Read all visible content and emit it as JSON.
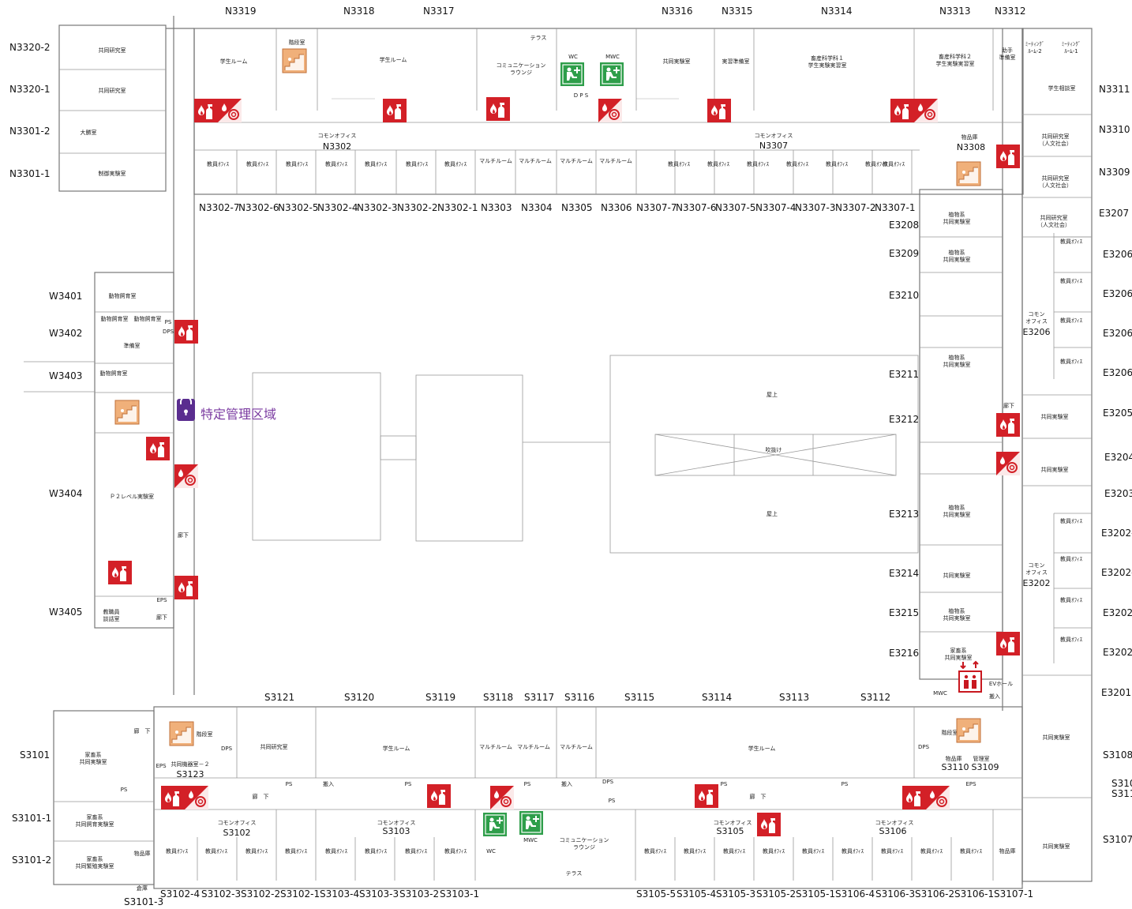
{
  "top_rooms": [
    "N3319",
    "N3318",
    "N3317",
    "N3316",
    "N3315",
    "N3314",
    "N3313",
    "N3312"
  ],
  "left_north_rooms": [
    "N3320-2",
    "N3320-1",
    "N3301-2",
    "N3301-1"
  ],
  "north_bottom_rooms": [
    "N3302-7",
    "N3302-6",
    "N3302-5",
    "N3302-4",
    "N3302-3",
    "N3302-2",
    "N3302-1",
    "N3303",
    "N3304",
    "N3305",
    "N3306",
    "N3307-7",
    "N3307-6",
    "N3307-5",
    "N3307-4",
    "N3307-3",
    "N3307-2",
    "N3307-1"
  ],
  "north_inner_labels": [
    "N3302",
    "N3307",
    "N3308"
  ],
  "east_outer_rooms": [
    "N3311",
    "N3310",
    "N3309",
    "E3207",
    "E3206-",
    "E3206-",
    "E3206-",
    "E3206-",
    "E3205",
    "E3204",
    "E3203",
    "E3202-",
    "E3202-",
    "E3202-",
    "E3202-",
    "E3201",
    "S3108",
    "S310",
    "S311",
    "S3107"
  ],
  "east_inner_rooms": [
    "E3208",
    "E3209",
    "E3210",
    "E3211",
    "E3212",
    "E3213",
    "E3214",
    "E3215",
    "E3216",
    "E3206",
    "E3202"
  ],
  "west_rooms": [
    "W3401",
    "W3402",
    "W3403",
    "W3404",
    "W3405"
  ],
  "south_top_rooms": [
    "S3121",
    "S3120",
    "S3119",
    "S3118",
    "S3117",
    "S3116",
    "S3115",
    "S3114",
    "S3113",
    "S3112"
  ],
  "south_left_rooms": [
    "S3101",
    "S3101-1",
    "S3101-2",
    "S3101-3"
  ],
  "south_inner_labels": [
    "S3123",
    "S3102",
    "S3103",
    "S3105",
    "S3106",
    "S3110",
    "S3109"
  ],
  "south_bottom_rooms": [
    "S3102-4",
    "S3102-3",
    "S3102-2",
    "S3102-1",
    "S3103-4",
    "S3103-3",
    "S3103-2",
    "S3103-1",
    "S3105-5",
    "S3105-4",
    "S3105-3",
    "S3105-2",
    "S3105-1",
    "S3106-4",
    "S3106-3",
    "S3106-2",
    "S3106-1",
    "S3107-1"
  ],
  "restricted_area": "特定管理区域",
  "small_texts": {
    "n_kyodo1": "共同研究室",
    "n_kyodo2": "共同研究室",
    "n_taiki": "大勝室",
    "n_sokutei": "制御実験室",
    "n_gakusei1": "学生ルーム",
    "n_gakusei2": "学生ルーム",
    "n_kaidan": "階段室",
    "n_terrace": "テラス",
    "n_comm": "コミュニケーション\nラウンジ",
    "n_wc": "WC",
    "n_mwc": "MWC",
    "n_dps": "D P S",
    "n_kyodo_jikken": "共同実験室",
    "n_jisshu": "実習準備室",
    "n_kasei1": "畜産科学科１\n学生実験実習室",
    "n_kasei2": "畜産科学科２\n学生実験実習室",
    "n_jokyo": "助手\n準備室",
    "n_meeting1": "ﾐｰﾃｨﾝｸﾞ\nﾙｰﾑ-2",
    "n_meeting2": "ﾐｰﾃｨﾝｸﾞ\nﾙｰﾑ-1",
    "n_gakusei_sodan": "学生相談室",
    "n_common_office": "コモンオフィス",
    "n_kyoin": "教員ｵﾌｨｽ",
    "n_multi": "マルチルーム",
    "n_bussan": "物品庫",
    "e_kyodo_jinbun": "共同研究室\n（人文社会）",
    "e_shokubutsu": "植物系\n共同実験室",
    "e_common_office": "コモン\nオフィス",
    "e_kyodo_jikken": "共同実験室",
    "e_kachiku": "家畜系\n共同実験室",
    "e_ev": "EVホール",
    "e_mwc": "MWC",
    "e_roka": "廊下",
    "e_okujo": "屋上",
    "e_fukinuke": "吹抜け",
    "e_hannyu": "搬入",
    "w_dobutsu": "動物飼育室",
    "w_junbi": "準備室",
    "w_p2": "Ｐ２レベル実験室",
    "w_kyoin_kaigi": "教職員\n談話室",
    "w_roka": "廊下",
    "w_ps": "PS",
    "w_eps": "EPS",
    "w_dps": "DPS",
    "s_kyodo_kenkyu": "共同研究室",
    "s_kasei_kyodo": "家畜系\n共同実験室",
    "s_kasei_shiiku": "家畜系\n共同飼育実験室",
    "s_kasei_hanshoku": "家畜系\n共同繁殖実験室",
    "s_kyodo_kiki": "共同機器室－２",
    "s_gakusei": "学生ルーム",
    "s_multi": "マルチルーム",
    "s_comm": "コミュニケーション\nラウンジ",
    "s_terrace": "テラス",
    "s_common_office": "コモンオフィス",
    "s_kyoin": "教員ｵﾌｨｽ",
    "s_bussan": "物品庫",
    "s_kaidan": "階段室",
    "s_roka": "廊　下",
    "s_wc": "WC",
    "s_mwc": "MWC",
    "s_bussan2": "物品庫",
    "s_kenri": "管理室",
    "s_kyodo_jikken": "共同実験室",
    "s_hannyu": "搬入",
    "s_eps": "EPS",
    "s_ps": "PS",
    "s_dps": "DPS",
    "s_kogai": "倉庫"
  },
  "colors": {
    "fire_red": "#d32027",
    "first_aid_green": "#2e9e4a",
    "stairs_orange": "#e9a56a",
    "restricted_purple": "#6a2d91",
    "elevator_red": "#c8181f"
  }
}
